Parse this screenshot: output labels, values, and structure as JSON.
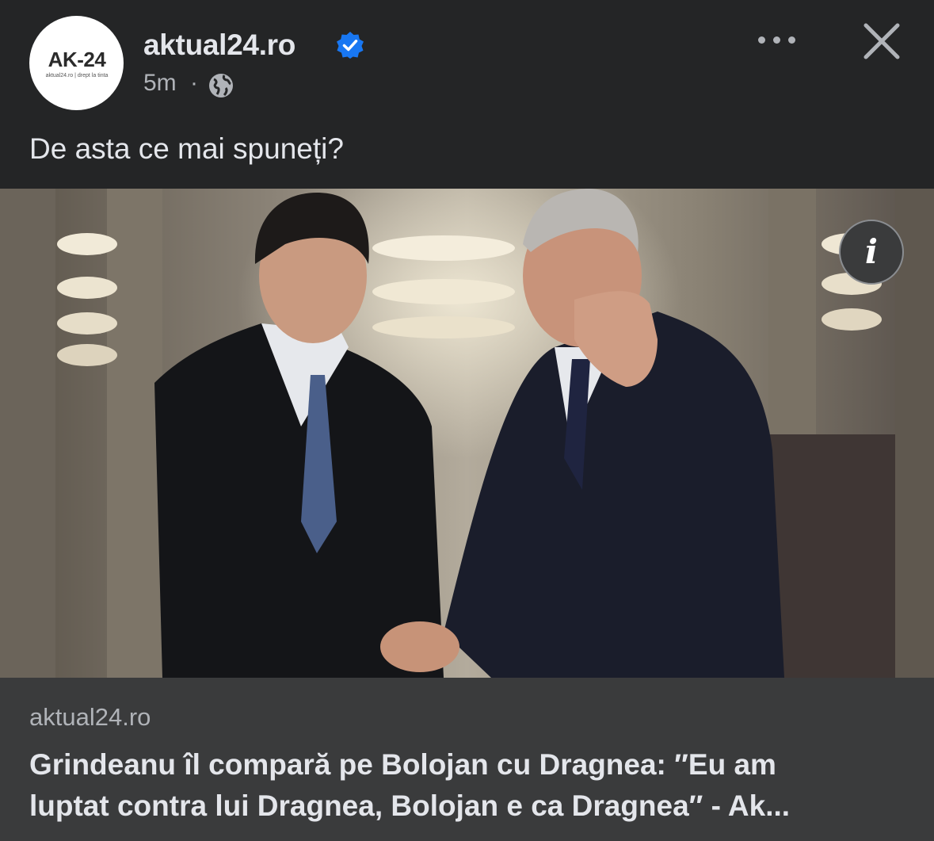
{
  "post": {
    "page_name": "aktual24.ro",
    "time": "5m",
    "separator": "·",
    "caption": "De asta ce mai spuneți?",
    "avatar": {
      "logo_text": "AK-24",
      "tagline": "aktual24.ro | drept la tinta"
    },
    "icons": {
      "verified": "verified-badge-icon",
      "audience": "globe-icon",
      "more": "more-options-icon",
      "close": "close-icon",
      "info": "info-icon"
    },
    "info_label": "i"
  },
  "link_preview": {
    "domain": "aktual24.ro",
    "headline_line1": "Grindeanu îl compară pe Bolojan cu Dragnea: ″Eu am",
    "headline_line2": "luptat contra lui Dragnea, Bolojan e ca Dragnea″ - Ak..."
  },
  "colors": {
    "background": "#242526",
    "preview_background": "#3a3b3c",
    "primary_text": "#e4e6eb",
    "secondary_text": "#b0b3b8",
    "verified_blue": "#1877f2",
    "logo_accent": "#f0a21b"
  }
}
